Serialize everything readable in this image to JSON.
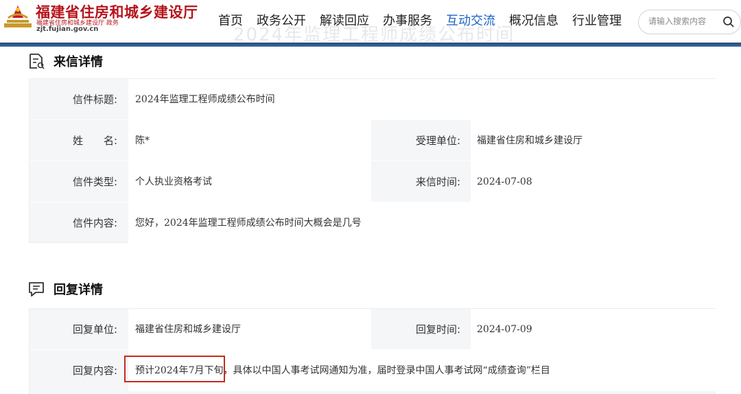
{
  "header": {
    "site_title": "福建省住房和城乡建设厅",
    "site_subtitle": "福建省住房和城乡建设厅 政务",
    "site_domain": "zjt.fujian.gov.cn",
    "ghost_title": "2024年监理工程师成绩公布时间",
    "nav": [
      "首页",
      "政务公开",
      "解读回应",
      "办事服务",
      "互动交流",
      "概况信息",
      "行业管理"
    ],
    "active_nav": "互动交流",
    "search_placeholder": "请输入搜索内容",
    "accent_color": "#1a64c8",
    "brand_color": "#b5131b"
  },
  "letter": {
    "section_title": "来信详情",
    "rows": {
      "title": {
        "label": "信件标题:",
        "value": "2024年监理工程师成绩公布时间"
      },
      "name": {
        "label": "姓　　名:",
        "value": "陈*"
      },
      "unit": {
        "label": "受理单位:",
        "value": "福建省住房和城乡建设厅"
      },
      "type": {
        "label": "信件类型:",
        "value": "个人执业资格考试"
      },
      "date": {
        "label": "来信时间:",
        "value": "2024-07-08"
      },
      "content": {
        "label": "信件内容:",
        "value": "您好，2024年监理工程师成绩公布时间大概会是几号"
      }
    }
  },
  "reply": {
    "section_title": "回复详情",
    "rows": {
      "unit": {
        "label": "回复单位:",
        "value": "福建省住房和城乡建设厅"
      },
      "date": {
        "label": "回复时间:",
        "value": "2024-07-09"
      },
      "content": {
        "label": "回复内容:",
        "highlight": "预计2024年7月下旬",
        "value_rest": "，具体以中国人事考试网通知为准，届时登录中国人事考试网“成绩查询”栏目"
      }
    }
  }
}
